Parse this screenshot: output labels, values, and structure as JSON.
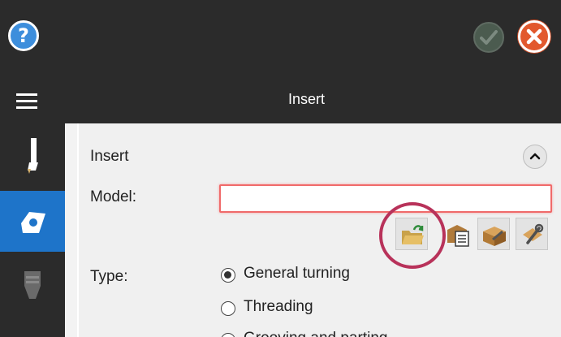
{
  "topbar": {
    "help_icon": "help-icon",
    "help_glyph": "?",
    "ok_icon": "ok-icon",
    "cancel_icon": "cancel-icon"
  },
  "titlebar": {
    "title": "Insert",
    "menu_icon": "hamburger-menu-icon"
  },
  "rail": {
    "items": [
      {
        "icon": "tool-holder-icon",
        "active": false
      },
      {
        "icon": "insert-icon",
        "active": true
      },
      {
        "icon": "tool-assembly-icon",
        "active": false
      }
    ],
    "active_color": "#1e74c9"
  },
  "panel": {
    "section_title": "Insert",
    "model_label": "Model:",
    "model_value": "",
    "type_label": "Type:",
    "type_options": [
      {
        "label": "General turning",
        "checked": true
      },
      {
        "label": "Threading",
        "checked": false
      },
      {
        "label": "Grooving and parting",
        "checked": false
      }
    ],
    "tool_buttons": [
      {
        "icon": "open-folder-icon"
      },
      {
        "icon": "insert-library-icon"
      },
      {
        "icon": "box-tool-icon"
      },
      {
        "icon": "wrench-settings-icon"
      }
    ]
  },
  "colors": {
    "dark_bg": "#2b2b2b",
    "accent_blue": "#1e74c9",
    "error_border": "#f06a6a",
    "highlight_ring": "#b8325a",
    "cancel_orange": "#e2582d"
  }
}
